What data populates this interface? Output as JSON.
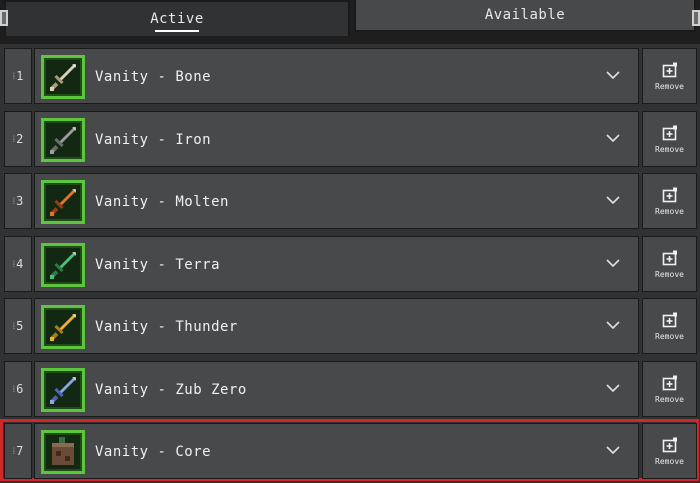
{
  "tabs": {
    "active": "Active",
    "available": "Available"
  },
  "rows": [
    {
      "index": "1",
      "name": "Vanity - Bone",
      "icon": "bone-sword-icon",
      "blade": "#d9d2bd",
      "hilt": "#a89878"
    },
    {
      "index": "2",
      "name": "Vanity - Iron",
      "icon": "iron-sword-icon",
      "blade": "#9c9c9c",
      "hilt": "#6b6b6b"
    },
    {
      "index": "3",
      "name": "Vanity - Molten",
      "icon": "molten-sword-icon",
      "blade": "#e0762a",
      "hilt": "#9a3b12"
    },
    {
      "index": "4",
      "name": "Vanity - Terra",
      "icon": "terra-sword-icon",
      "blade": "#4fbf7c",
      "hilt": "#2c7a4b"
    },
    {
      "index": "5",
      "name": "Vanity - Thunder",
      "icon": "thunder-sword-icon",
      "blade": "#e8b432",
      "hilt": "#a97a1a"
    },
    {
      "index": "6",
      "name": "Vanity - Zub Zero",
      "icon": "zub-zero-sword-icon",
      "blade": "#8aa6e8",
      "hilt": "#4f67b0"
    },
    {
      "index": "7",
      "name": "Vanity - Core",
      "icon": "core-block-icon",
      "blade": "#6b4a36",
      "hilt": "#3e2a1e"
    }
  ],
  "remove_label": "Remove",
  "selected_index": 6,
  "colors": {
    "selection": "#d0282a",
    "frame": "#5ec63e"
  }
}
